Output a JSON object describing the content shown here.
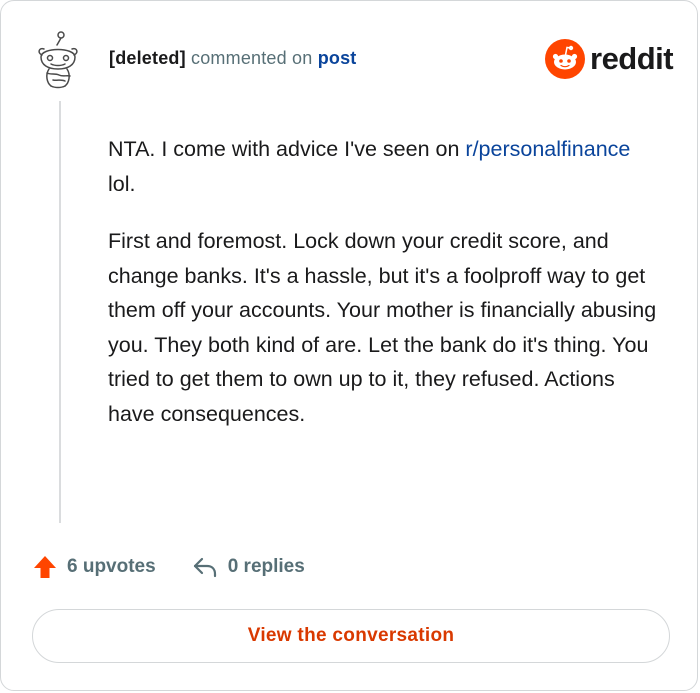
{
  "header": {
    "author": "[deleted]",
    "action": "commented on",
    "post_link": "post"
  },
  "logo": {
    "wordmark": "reddit",
    "icon": "reddit-snoo-icon",
    "color": "#ff4500"
  },
  "avatar": {
    "icon": "deleted-user-snoo-icon"
  },
  "comment": {
    "paragraph1_before_link": "NTA. I come with advice I've seen on ",
    "subreddit_link": "r/personalfinance",
    "paragraph1_after_link": " lol.",
    "paragraph2": "First and foremost. Lock down your credit score, and change banks. It's a hassle, but it's a foolproff way to get them off your accounts. Your mother is financially abusing you. They both kind of are. Let the bank do it's thing. You tried to get them to own up to it, they refused. Actions have consequences."
  },
  "stats": {
    "upvotes": "6 upvotes",
    "replies": "0 replies",
    "upvote_icon": "upvote-arrow-icon",
    "reply_icon": "reply-arrow-icon"
  },
  "cta": {
    "label": "View the conversation"
  },
  "colors": {
    "accent": "#d93900",
    "link": "#0a449b",
    "muted": "#576f76",
    "text": "#1a1a1b",
    "border": "#d4d7d9"
  }
}
